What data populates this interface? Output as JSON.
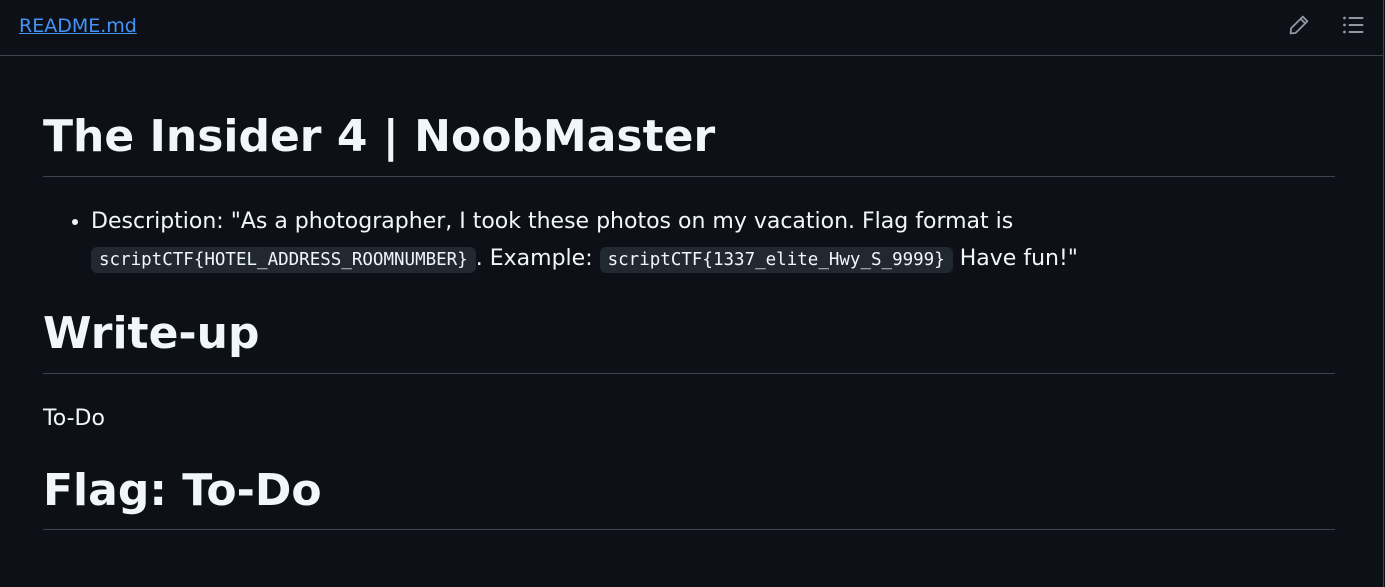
{
  "file_header": {
    "filename": "README.md",
    "edit_icon": "pencil-icon",
    "outline_icon": "list-unordered-icon"
  },
  "document": {
    "title": "The Insider 4 | NoobMaster",
    "description": {
      "prefix": "Description: \"As a photographer, I took these photos on my vacation. Flag format is ",
      "code_format": "scriptCTF{HOTEL_ADDRESS_ROOMNUMBER}",
      "middle": ". Example: ",
      "code_example": "scriptCTF{1337_elite_Hwy_S_9999}",
      "suffix": " Have fun!\""
    },
    "writeup_heading": "Write-up",
    "writeup_body": "To-Do",
    "flag_heading": "Flag: To-Do"
  },
  "colors": {
    "background": "#0d1117",
    "text": "#f0f6fc",
    "link": "#4493f8",
    "border": "#3d444d",
    "code_bg": "#212830",
    "icon": "#9198a1"
  }
}
